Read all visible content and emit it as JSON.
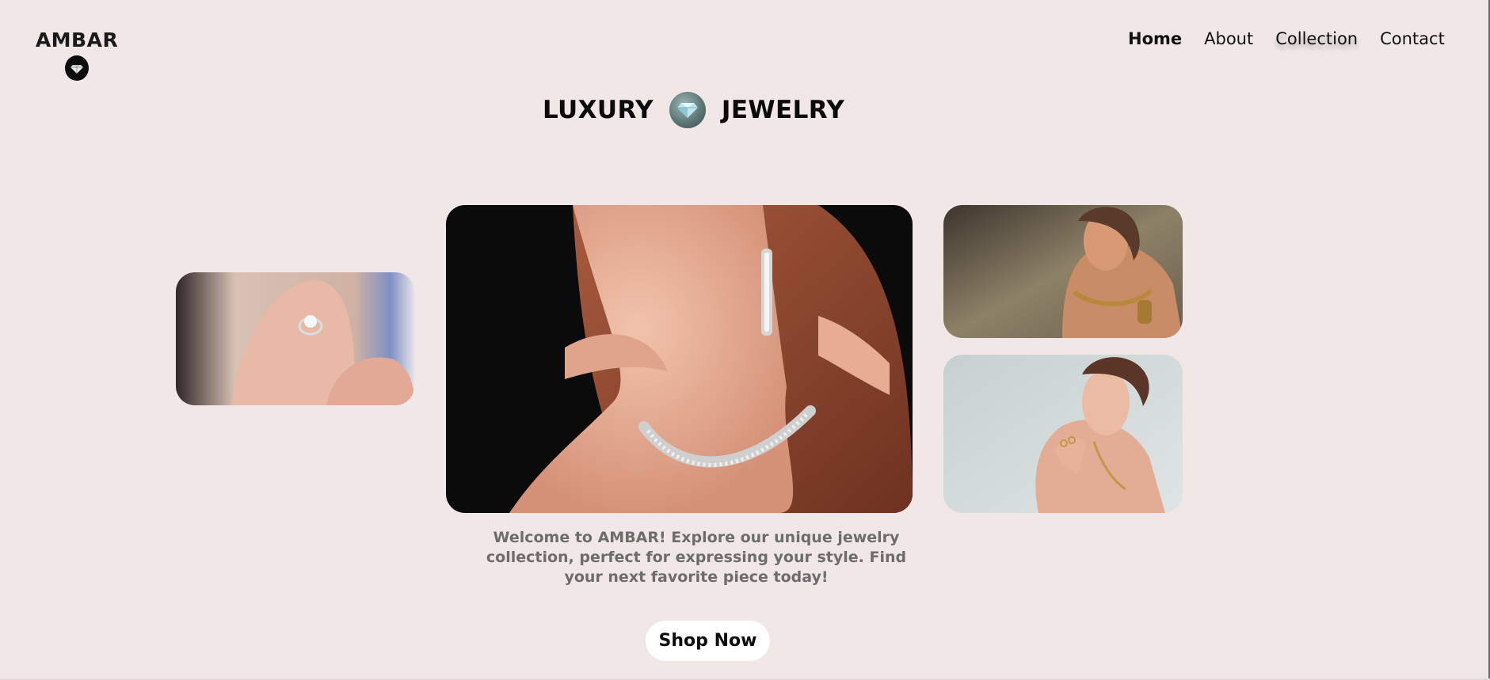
{
  "brand": {
    "name": "AMBAR",
    "logo_icon": "diamond-icon"
  },
  "nav": {
    "items": [
      {
        "label": "Home",
        "active": true
      },
      {
        "label": "About",
        "active": false
      },
      {
        "label": "Collection",
        "active": false
      },
      {
        "label": "Contact",
        "active": false
      }
    ]
  },
  "hero": {
    "title_left": "LUXURY",
    "title_icon": "diamond-gem-icon",
    "title_right": "JEWELRY",
    "description": "Welcome to AMBAR! Explore our unique jewelry collection, perfect for expressing your style. Find your next favorite piece today!",
    "cta_label": "Shop Now"
  },
  "gallery": {
    "images": [
      "ring-photo",
      "necklace-earrings-photo",
      "gold-jewelry-model-photo",
      "gold-rings-model-photo"
    ]
  },
  "colors": {
    "background": "#f1e7e7",
    "text": "#111111",
    "muted_text": "#6d6d6d",
    "button_bg": "#ffffff"
  }
}
